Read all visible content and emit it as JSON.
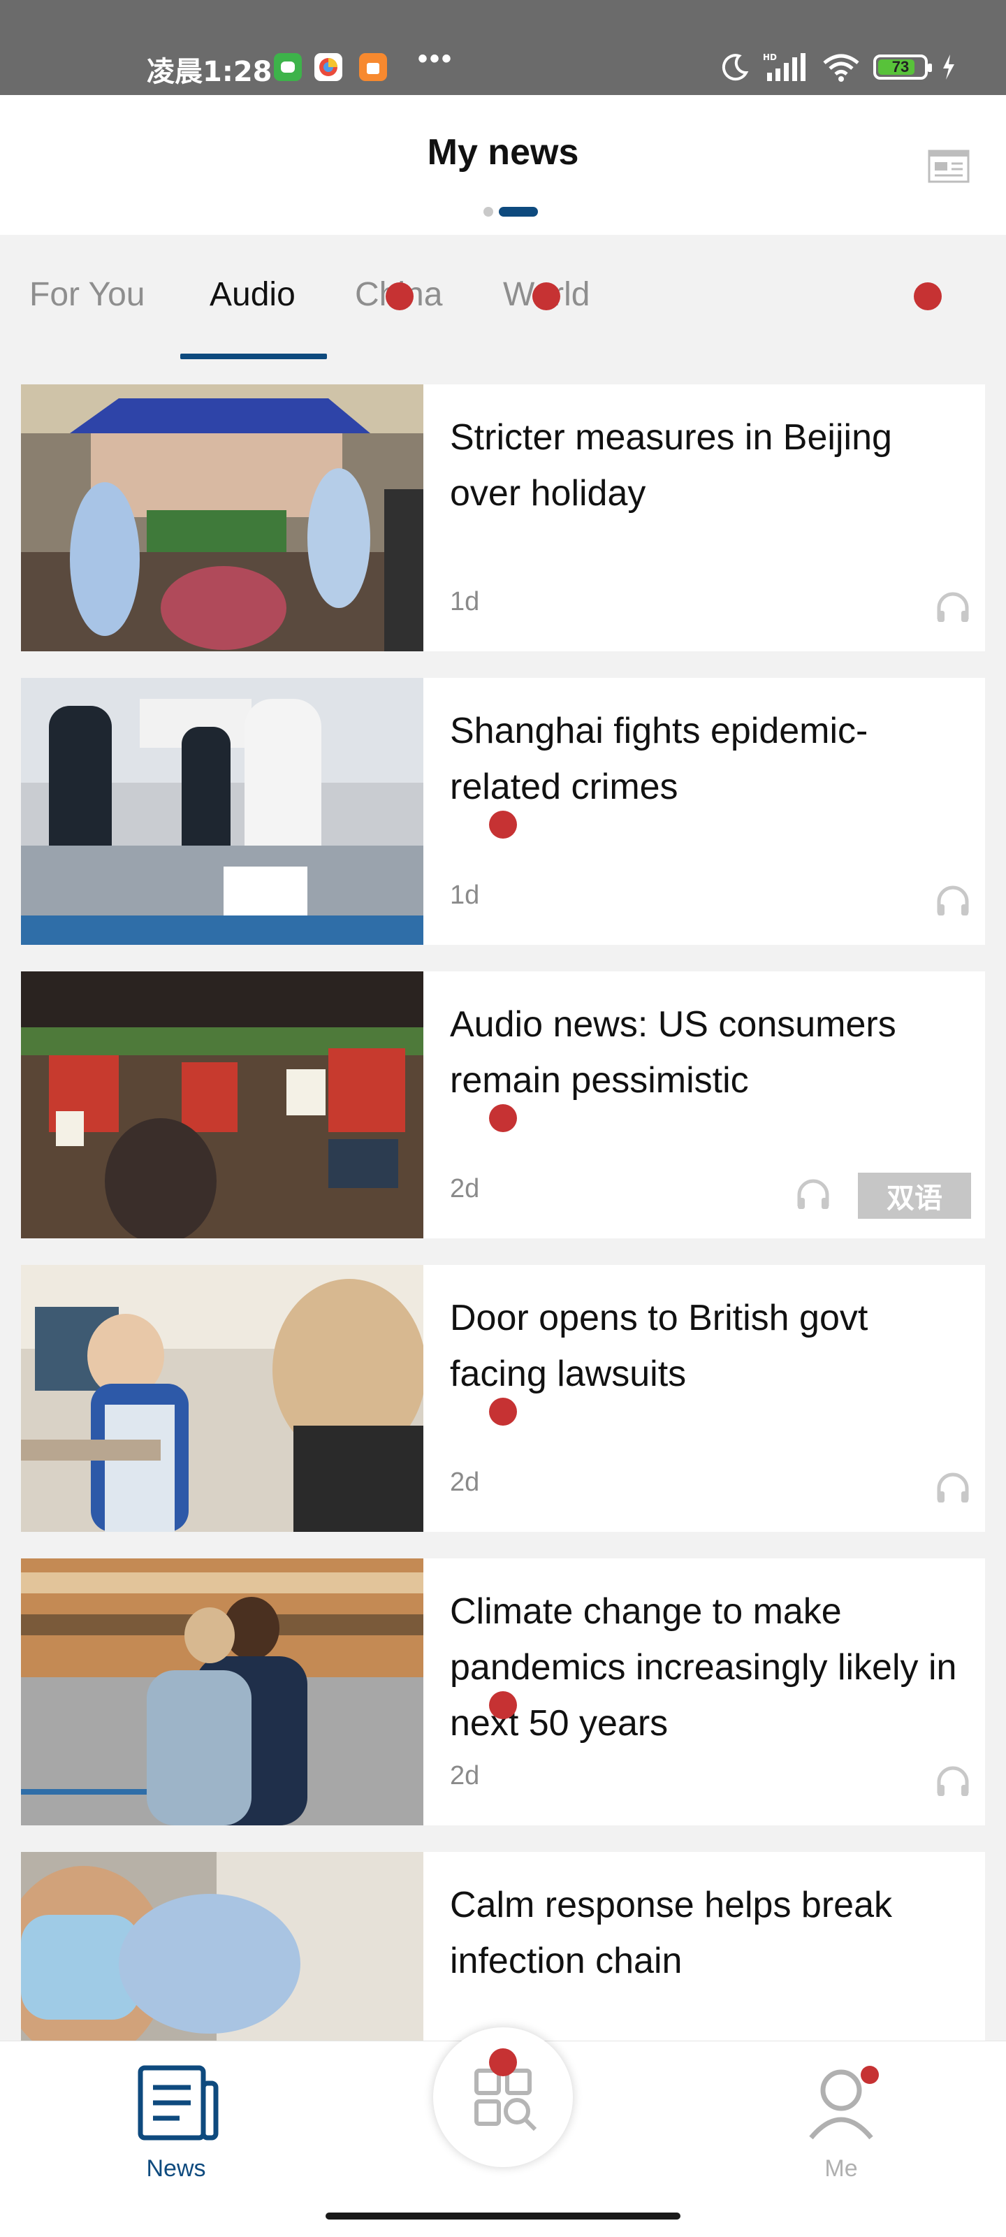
{
  "status_bar": {
    "time": "凌晨1:28",
    "more": "•••",
    "battery": "73",
    "colors": {
      "wechat": "#3db34a",
      "app2": "#ffffff",
      "app3": "#f7892f",
      "battery_fill": "#58c23a"
    },
    "icons": [
      "moon-icon",
      "signal-icon",
      "wifi-icon",
      "battery-icon",
      "charging-icon"
    ]
  },
  "header": {
    "title": "My news",
    "icon": "layout-icon"
  },
  "tabs": [
    {
      "label": "For You"
    },
    {
      "label": "Audio"
    },
    {
      "label": "China"
    },
    {
      "label": "World"
    }
  ],
  "articles": [
    {
      "title": "Stricter measures in Beijing over holiday",
      "time": "1d",
      "icon": "headphone-icon"
    },
    {
      "title": "Shanghai fights epidemic-related crimes",
      "time": "1d",
      "icon": "headphone-icon"
    },
    {
      "title": "Audio news: US consumers remain pessimistic",
      "time": "2d",
      "icon": "headphone-icon",
      "badge": "双语"
    },
    {
      "title": "Door opens to British govt facing lawsuits",
      "time": "2d",
      "icon": "headphone-icon"
    },
    {
      "title": "Climate change to make pandemics increasingly likely in next 50 years",
      "time": "2d",
      "icon": "headphone-icon"
    },
    {
      "title": "Calm response helps break infection chain",
      "time": "",
      "icon": ""
    }
  ],
  "bottom_nav": {
    "news": "News",
    "discover": "",
    "me": "Me"
  },
  "colors": {
    "accent": "#0e4a7e",
    "red_marker": "#c63233"
  }
}
